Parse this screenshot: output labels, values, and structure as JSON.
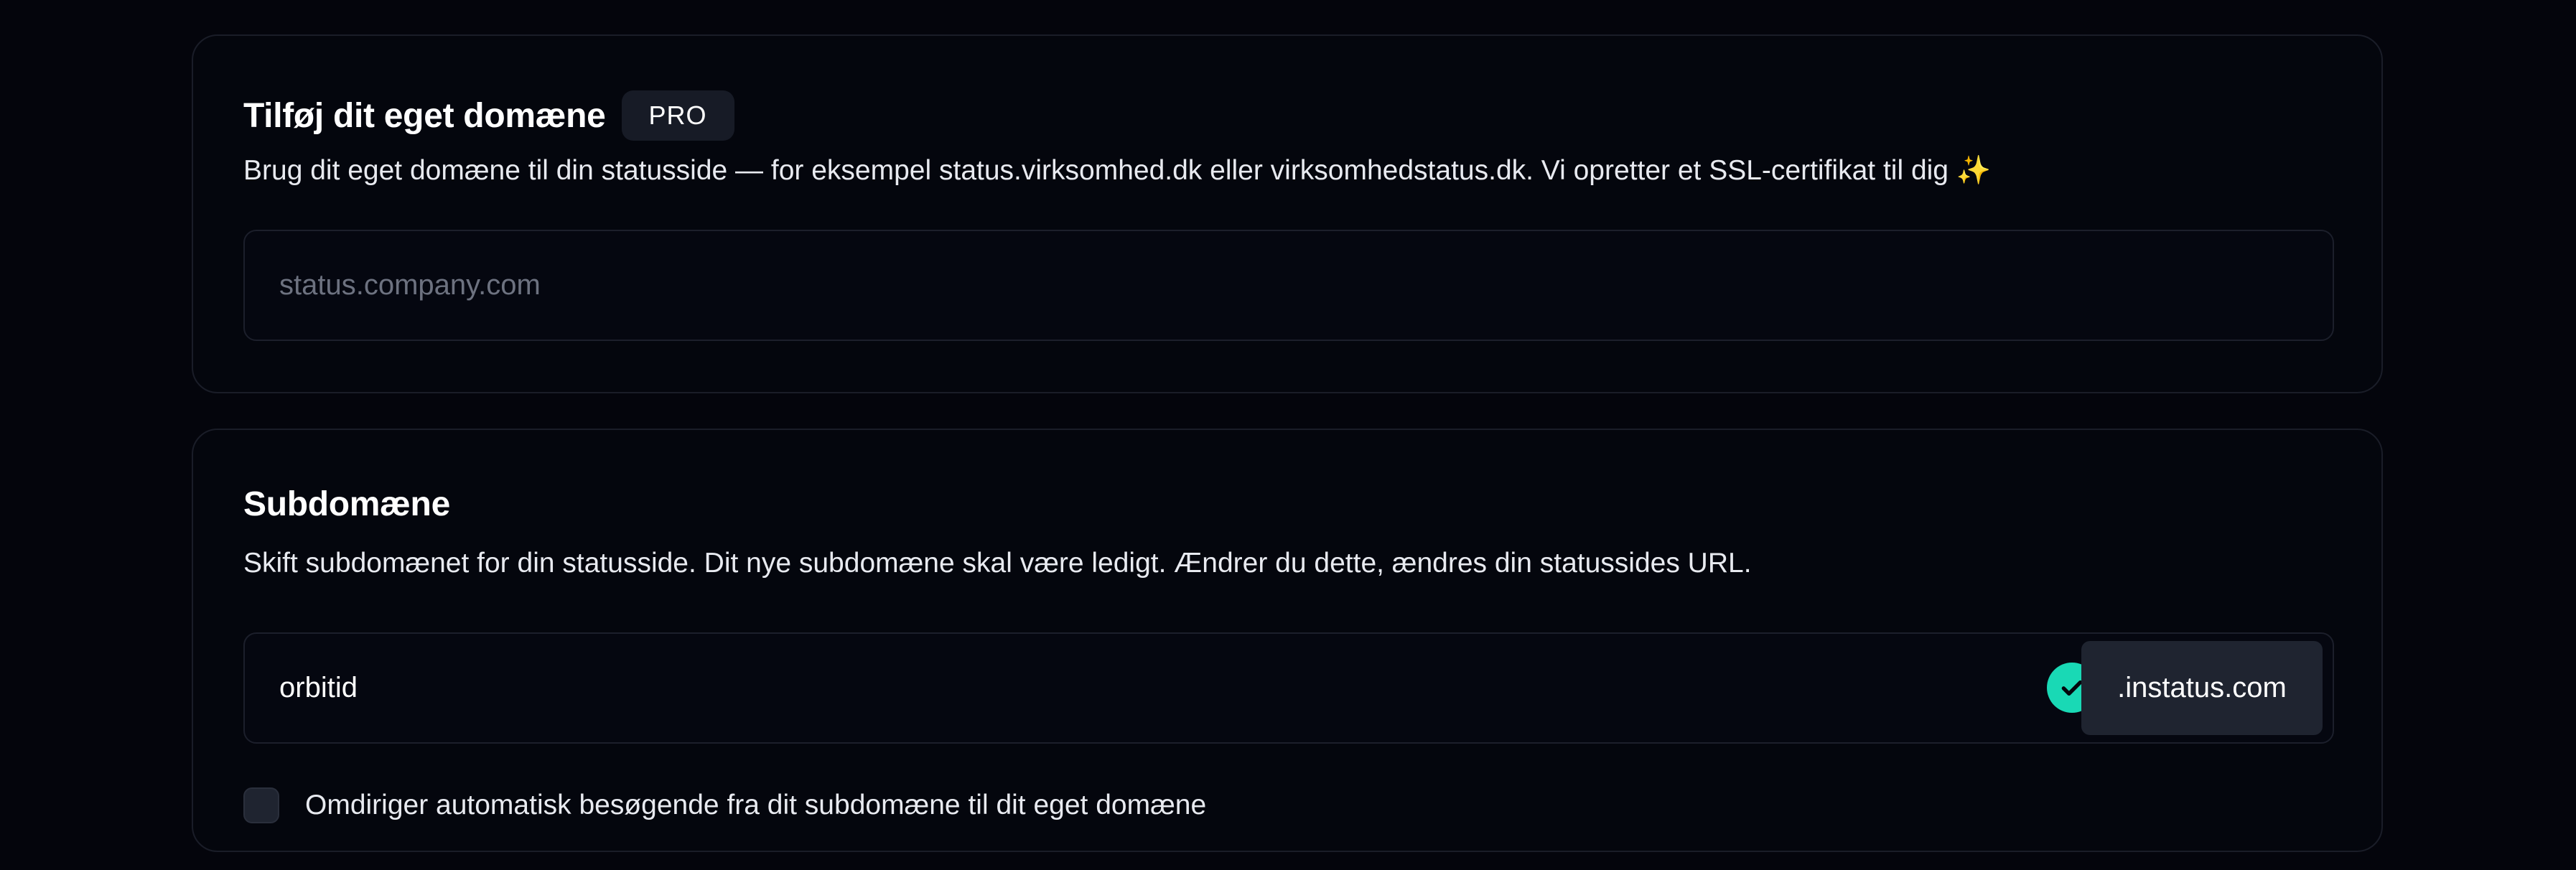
{
  "custom_domain": {
    "title": "Tilføj dit eget domæne",
    "badge": "PRO",
    "description": "Brug dit eget domæne til din statusside — for eksempel status.virksomhed.dk eller virksomhedstatus.dk. Vi opretter et SSL-certifikat til dig ✨",
    "input_value": "",
    "input_placeholder": "status.company.com"
  },
  "subdomain": {
    "title": "Subdomæne",
    "description": "Skift subdomænet for din statusside. Dit nye subdomæne skal være ledigt. Ændrer du dette, ændres din statussides URL.",
    "input_value": "orbitid",
    "suffix": ".instatus.com",
    "status_icon": "check-circle-icon",
    "redirect_checkbox_label": "Omdiriger automatisk besøgende fra dit subdomæne til dit eget domæne",
    "redirect_checked": false
  },
  "colors": {
    "background": "#04050c",
    "card_border": "#1a1d28",
    "check_accent": "#19d9b5",
    "badge_bg": "#171b26",
    "suffix_bg": "#1f2430"
  }
}
